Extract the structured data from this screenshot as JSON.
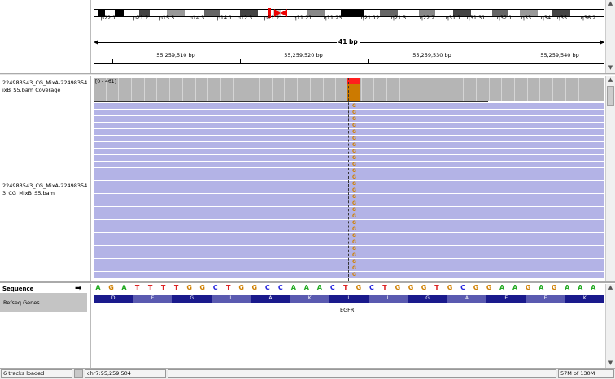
{
  "ideogram": {
    "bands": [
      "p22.1",
      "p21.2",
      "p15.3",
      "p14.3",
      "p14.1",
      "p12.3",
      "p11.2",
      "q11.21",
      "q11.23",
      "q21.12",
      "q21.3",
      "q22.2",
      "q31.1",
      "q31.31",
      "q32.1",
      "q33",
      "q34",
      "q35",
      "q36.2"
    ]
  },
  "ruler": {
    "span_label": "41 bp",
    "ticks": [
      "55,259,510 bp",
      "55,259,520 bp",
      "55,259,530 bp",
      "55,259,540 bp"
    ]
  },
  "tracks": {
    "coverage_name": "224983543_CG_MixA-22498354\nixB_S5.bam Coverage",
    "coverage_range": "[0 - 461]",
    "alignment_name": "224983543_CG_MixA-22498354\n3_CG_MixB_S5.bam",
    "mismatch_base": "G"
  },
  "features": {
    "sequence_label": "Sequence",
    "sequence_arrow": "➡",
    "refseq_label": "Refseq Genes",
    "bases": [
      "A",
      "G",
      "A",
      "T",
      "T",
      "T",
      "T",
      "G",
      "G",
      "C",
      "T",
      "G",
      "G",
      "C",
      "C",
      "A",
      "A",
      "A",
      "C",
      "T",
      "G",
      "C",
      "T",
      "G",
      "G",
      "G",
      "T",
      "G",
      "C",
      "G",
      "G",
      "A",
      "A",
      "G",
      "A",
      "G",
      "A",
      "A",
      "A"
    ],
    "amino_acids": [
      "D",
      "F",
      "G",
      "L",
      "A",
      "K",
      "L",
      "L",
      "G",
      "A",
      "E",
      "E",
      "K"
    ],
    "gene_name": "EGFR"
  },
  "status": {
    "tracks_loaded": "6 tracks loaded",
    "locus": "chr7:55,259,504",
    "memory": "57M of 130M"
  },
  "colors": {
    "base_A": "#22aa22",
    "base_C": "#2222dd",
    "base_G": "#d08000",
    "base_T": "#dd2222",
    "read": "#b3b3e6",
    "coverage": "#b5b5b5",
    "amino_dark": "#1a1a8c",
    "amino_light": "#5a5ab0"
  }
}
